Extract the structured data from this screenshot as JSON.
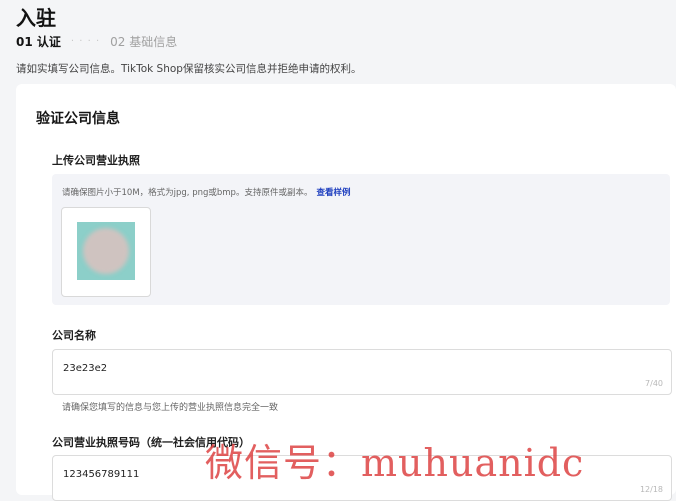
{
  "header": {
    "title": "入驻",
    "steps": [
      {
        "label": "01 认证",
        "active": true
      },
      {
        "label": "02 基础信息",
        "active": false
      }
    ],
    "step_separator": "· · · ·",
    "notice": "请如实填写公司信息。TikTok Shop保留核实公司信息并拒绝申请的权利。"
  },
  "form": {
    "section_title": "验证公司信息",
    "license_upload": {
      "label": "上传公司营业执照",
      "hint": "请确保图片小于10M，格式为jpg, png或bmp。支持原件或副本。",
      "example_link": "查看样例"
    },
    "company_name": {
      "label": "公司名称",
      "value": "23e23e2",
      "counter": "7/40",
      "help": "请确保您填写的信息与您上传的营业执照信息完全一致"
    },
    "license_number": {
      "label": "公司营业执照号码（统一社会信用代码）",
      "value": "123456789111",
      "counter": "12/18"
    }
  },
  "watermark": "微信号：muhuanidc",
  "colors": {
    "link": "#1f3fbf",
    "watermark": "#dc3c3c",
    "upload_bg": "#f3f4f8"
  }
}
